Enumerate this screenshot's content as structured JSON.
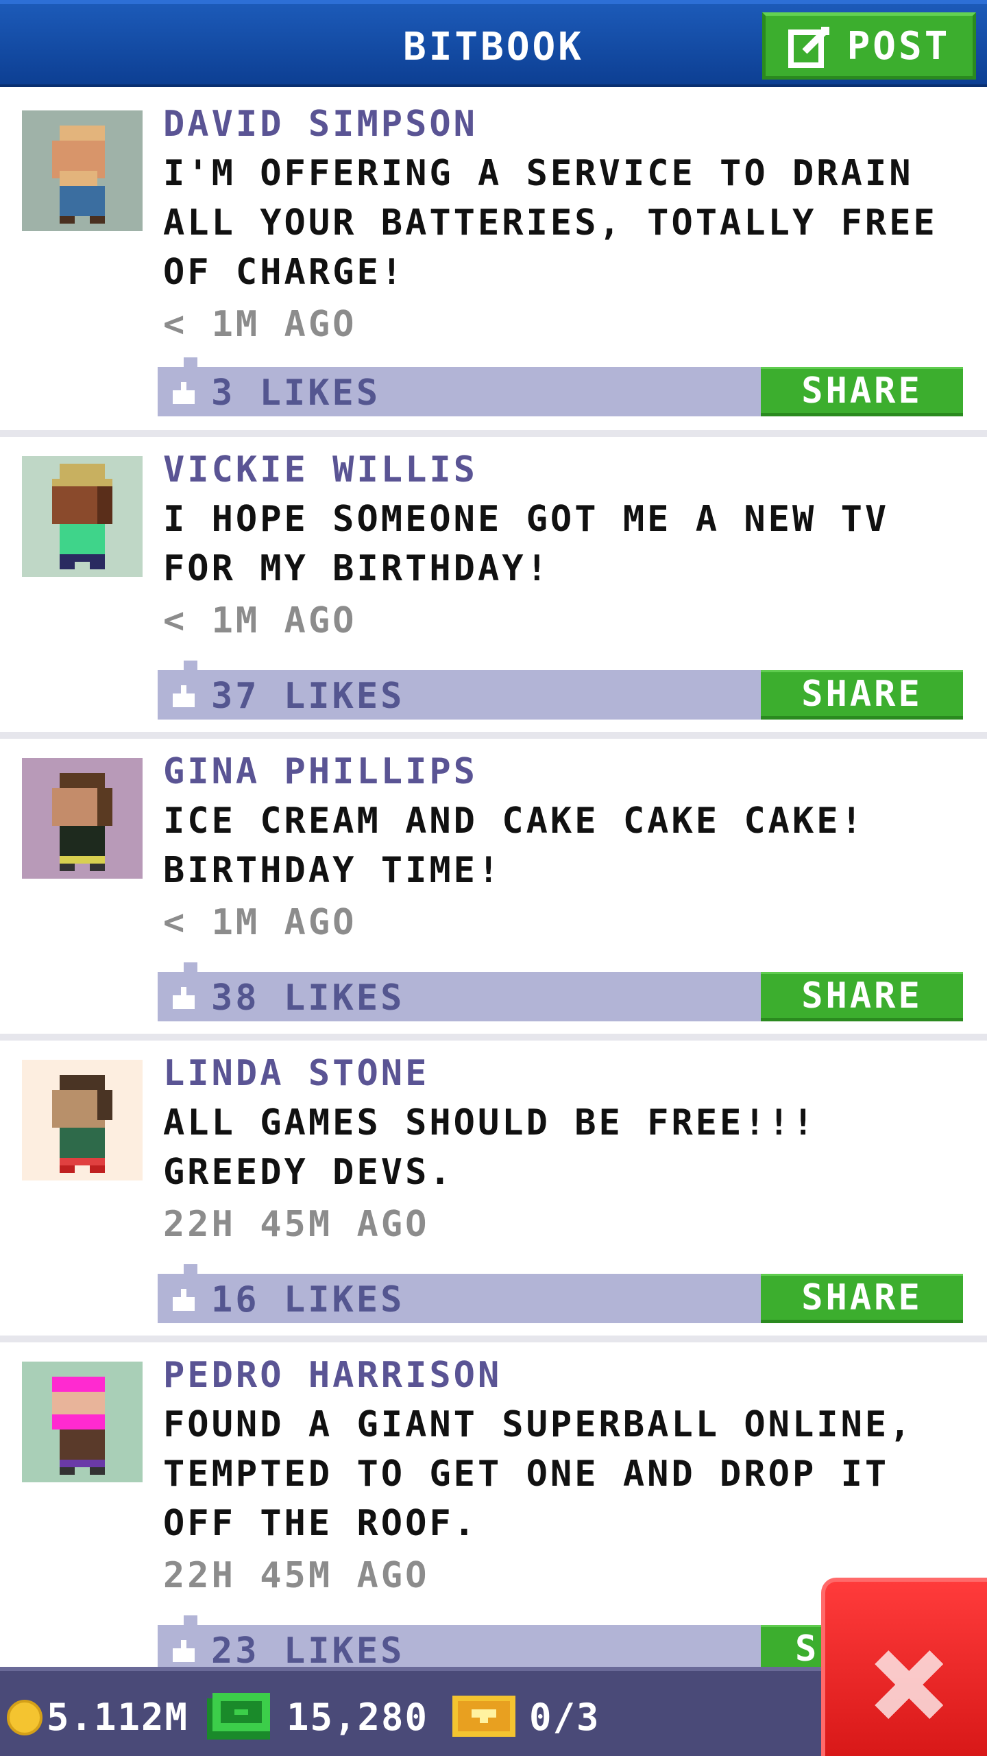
{
  "header": {
    "title": "BITBOOK",
    "post_label": "POST",
    "post_icon": "compose-icon"
  },
  "feed": [
    {
      "name": "DAVID SIMPSON",
      "text": "I'M OFFERING A SERVICE TO DRAIN ALL YOUR BATTERIES, TOTALLY FREE OF CHARGE!",
      "time": "< 1M AGO",
      "likes": "3 LIKES",
      "share": "SHARE",
      "avatar_bg": "#9fb2a8"
    },
    {
      "name": "VICKIE WILLIS",
      "text": "I HOPE SOMEONE GOT ME A NEW TV FOR MY BIRTHDAY!",
      "time": "< 1M AGO",
      "likes": "37 LIKES",
      "share": "SHARE",
      "avatar_bg": "#bfd7c6"
    },
    {
      "name": "GINA PHILLIPS",
      "text": "ICE CREAM AND CAKE CAKE CAKE! BIRTHDAY TIME!",
      "time": "< 1M AGO",
      "likes": "38 LIKES",
      "share": "SHARE",
      "avatar_bg": "#b89ab8"
    },
    {
      "name": "LINDA STONE",
      "text": "ALL GAMES SHOULD BE FREE!!! GREEDY DEVS.",
      "time": "22H 45M AGO",
      "likes": "16 LIKES",
      "share": "SHARE",
      "avatar_bg": "#fdeee0"
    },
    {
      "name": "PEDRO HARRISON",
      "text": "FOUND A GIANT SUPERBALL ONLINE, TEMPTED TO GET ONE AND DROP IT OFF THE ROOF.",
      "time": "22H 45M AGO",
      "likes": "23 LIKES",
      "share": "S",
      "avatar_bg": "#a9cfb7"
    }
  ],
  "status_bar": {
    "coins": "5.112M",
    "bux": "15,280",
    "tickets": "0/3"
  },
  "close_icon": "close-icon",
  "colors": {
    "header": "#1b57b3",
    "green": "#3cae2e",
    "like_bar": "#b2b4d6",
    "name": "#5a5494",
    "close": "#e82222"
  }
}
